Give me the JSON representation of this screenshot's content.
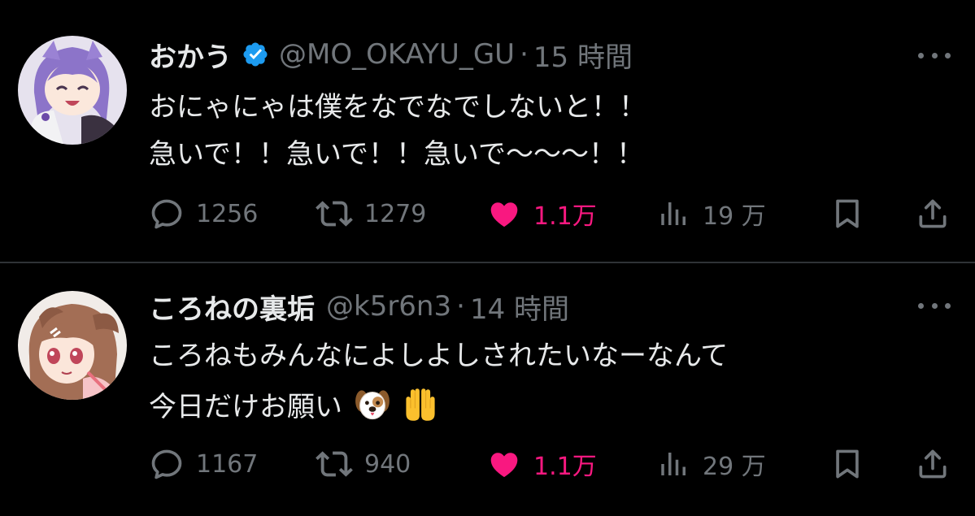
{
  "tweets": [
    {
      "display_name": "おかう",
      "verified": true,
      "handle": "@MO_OKAYU_GU",
      "separator": "·",
      "time": "15 時間",
      "text_lines": [
        "おにゃにゃは僕をなでなでしないと！！",
        "急いで！！急いで！！急いで〜〜〜！！"
      ],
      "stats": {
        "replies": "1256",
        "retweets": "1279",
        "likes": "1.1万",
        "views": "19 万"
      },
      "liked": true
    },
    {
      "display_name": "ころねの裏垢",
      "verified": false,
      "handle": "@k5r6n3",
      "separator": "·",
      "time": "14 時間",
      "text_lines": [
        "ころねもみんなによしよしされたいなーなんて",
        "今日だけお願い"
      ],
      "emojis": [
        "dog-face-emoji",
        "raising-hands-emoji"
      ],
      "stats": {
        "replies": "1167",
        "retweets": "940",
        "likes": "1.1万",
        "views": "29 万"
      },
      "liked": true
    }
  ],
  "colors": {
    "background": "#000000",
    "text": "#e7e9ea",
    "muted": "#71767b",
    "like": "#f91880",
    "verified": "#1d9bf0",
    "divider": "#2f3336"
  },
  "icons": {
    "reply": "speech-bubble-icon",
    "retweet": "retweet-arrows-icon",
    "like": "heart-icon",
    "views": "bar-chart-icon",
    "bookmark": "bookmark-icon",
    "share": "share-upload-icon",
    "more": "more-dots-icon"
  }
}
